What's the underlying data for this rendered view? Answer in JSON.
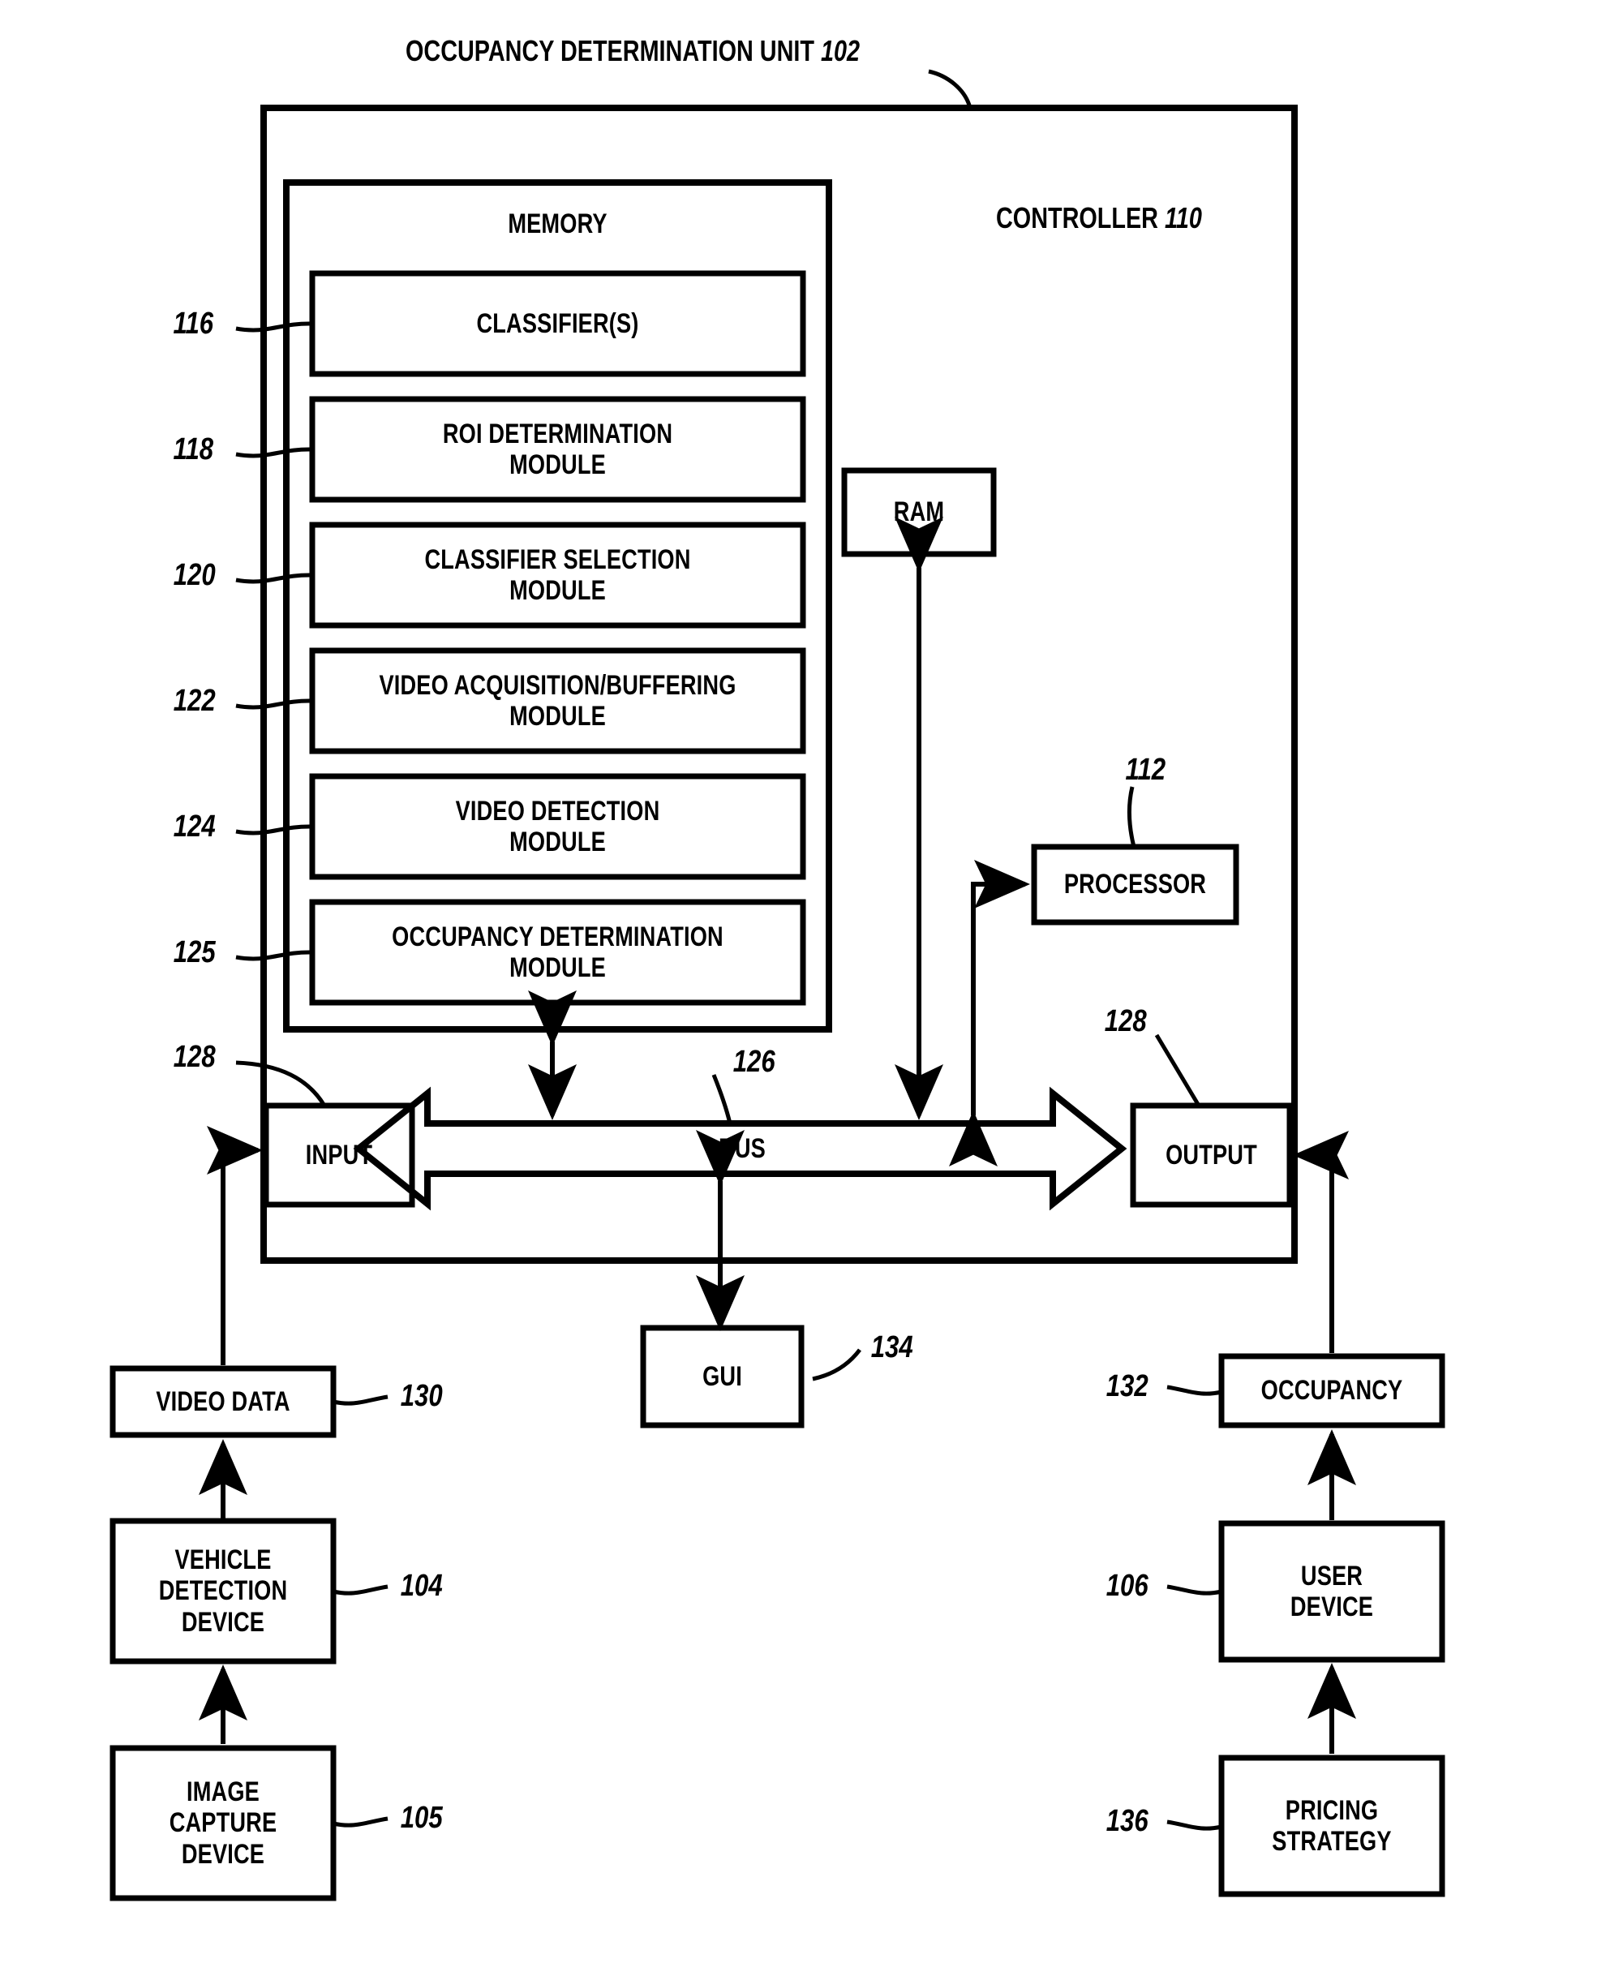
{
  "figure": {
    "title_text": "OCCUPANCY DETERMINATION UNIT",
    "title_ref": "102",
    "controller_text": "CONTROLLER",
    "controller_ref": "110",
    "memory_label": "MEMORY"
  },
  "memory_modules": [
    {
      "ref": "116",
      "label": "CLASSIFIER(S)"
    },
    {
      "ref": "118",
      "label": "ROI DETERMINATION\nMODULE"
    },
    {
      "ref": "120",
      "label": "CLASSIFIER SELECTION\nMODULE"
    },
    {
      "ref": "122",
      "label": "VIDEO ACQUISITION/BUFFERING\nMODULE"
    },
    {
      "ref": "124",
      "label": "VIDEO DETECTION\nMODULE"
    },
    {
      "ref": "125",
      "label": "OCCUPANCY DETERMINATION\nMODULE"
    }
  ],
  "controller_blocks": {
    "ram": {
      "label": "RAM"
    },
    "processor": {
      "label": "PROCESSOR",
      "ref": "112"
    },
    "input": {
      "label": "INPUT",
      "ref": "128"
    },
    "output": {
      "label": "OUTPUT",
      "ref": "128"
    },
    "bus": {
      "label": "BUS",
      "ref": "126"
    }
  },
  "external_blocks": [
    {
      "name": "gui",
      "label": "GUI",
      "ref": "134"
    },
    {
      "name": "video-data",
      "label": "VIDEO DATA",
      "ref": "130"
    },
    {
      "name": "vehicle-detection-device",
      "label": "VEHICLE\nDETECTION\nDEVICE",
      "ref": "104"
    },
    {
      "name": "image-capture-device",
      "label": "IMAGE\nCAPTURE\nDEVICE",
      "ref": "105"
    },
    {
      "name": "occupancy",
      "label": "OCCUPANCY",
      "ref": "132"
    },
    {
      "name": "user-device",
      "label": "USER\nDEVICE",
      "ref": "106"
    },
    {
      "name": "pricing-strategy",
      "label": "PRICING\nSTRATEGY",
      "ref": "136"
    }
  ],
  "colors": {
    "ink": "#000000",
    "paper": "#ffffff"
  }
}
